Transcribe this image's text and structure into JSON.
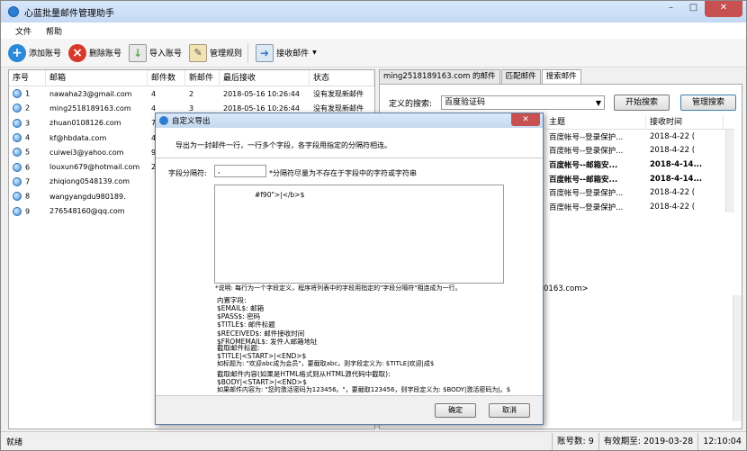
{
  "window": {
    "title": "心蓝批量邮件管理助手",
    "min": "–",
    "max": "□",
    "close": "✕"
  },
  "menu": {
    "file": "文件",
    "help": "帮助"
  },
  "toolbar": {
    "add": "添加账号",
    "delete": "删除账号",
    "import": "导入账号",
    "rules": "管理规则",
    "receive": "接收邮件",
    "receive_arrow": "▼"
  },
  "accounts": {
    "headers": [
      "序号",
      "邮箱",
      "邮件数",
      "新邮件",
      "最后接收",
      "状态"
    ],
    "rows": [
      {
        "no": "1",
        "email": "nawaha23@gmail.com",
        "count": "4",
        "new": "2",
        "last": "2018-05-16 10:26:44",
        "status": "没有发现新邮件"
      },
      {
        "no": "2",
        "email": "ming2518189163.com",
        "count": "4",
        "new": "3",
        "last": "2018-05-16 10:26:44",
        "status": "没有发现新邮件"
      },
      {
        "no": "3",
        "email": "zhuan0108126.com",
        "count": "7",
        "new": "",
        "last": "",
        "status": ""
      },
      {
        "no": "4",
        "email": "kf@hbdata.com",
        "count": "4",
        "new": "",
        "last": "",
        "status": ""
      },
      {
        "no": "5",
        "email": "cuiwei3@yahoo.com",
        "count": "9",
        "new": "",
        "last": "",
        "status": ""
      },
      {
        "no": "6",
        "email": "louxun679@hotmail.com",
        "count": "2",
        "new": "",
        "last": "",
        "status": ""
      },
      {
        "no": "7",
        "email": "zhiqiong0548139.com",
        "count": "",
        "new": "",
        "last": "",
        "status": ""
      },
      {
        "no": "8",
        "email": "wangyangdu980189.",
        "count": "",
        "new": "",
        "last": "",
        "status": ""
      },
      {
        "no": "9",
        "email": "276548160@qq.com",
        "count": "",
        "new": "",
        "last": "",
        "status": ""
      }
    ]
  },
  "right": {
    "tabs": [
      "ming2518189163.com 的邮件",
      "匹配邮件",
      "搜索邮件"
    ],
    "search_label": "定义的搜索:",
    "search_value": "百度验证码",
    "start_search": "开始搜索",
    "manage_search": "管理搜索",
    "list_headers": [
      "主题",
      "接收时间"
    ],
    "list_rows": [
      {
        "subject": "百度帐号--登录保护...",
        "time": "2018-4-22 (",
        "bold": false
      },
      {
        "subject": "百度帐号--登录保护...",
        "time": "2018-4-22 (",
        "bold": false
      },
      {
        "subject": "百度帐号--邮箱安...",
        "time": "2018-4-14...",
        "bold": true
      },
      {
        "subject": "百度帐号--邮箱安...",
        "time": "2018-4-14...",
        "bold": true
      },
      {
        "subject": "百度帐号--登录保护...",
        "time": "2018-4-22 (",
        "bold": false
      },
      {
        "subject": "百度帐号--登录保护...",
        "time": "2018-4-22 (",
        "bold": false
      }
    ],
    "preview_text": "0163.com>"
  },
  "dialog": {
    "title": "自定义导出",
    "close": "✕",
    "desc": "导出为一封邮件一行，一行多个字段，各字段用指定的分隔符相连。",
    "sep_label": "字段分隔符:",
    "sep_value": ",",
    "sep_hint": "*分隔符尽量为不存在于字段中的字符或字符串",
    "template_text": "#f90\">|</b>$",
    "note": "*说明: 每行为一个字段定义，程序将列表中的字段用指定的\"字段分隔符\"相连成为一行。",
    "builtin_title": "内置字段:",
    "builtin": [
      "$EMAIL$: 邮箱",
      "$PASS$: 密码",
      "$TITLE$: 邮件标题",
      "$RECEIVED$: 邮件接收时间",
      "$FROMEMAIL$: 发件人邮箱地址"
    ],
    "ex1_title": "截取邮件标题:",
    "ex1_code": "$TITLE|<START>|<END>$",
    "ex1_desc": "如标题为: \"欢迎abc成为会员\"，要截取abc，则字段定义为: $TITLE|欢迎|成$",
    "ex2_title": "截取邮件内容(如果是HTML格式则从HTML源代码中截取):",
    "ex2_code": "$BODY|<START>|<END>$",
    "ex2_desc": "如果邮件内容为: \"您的激活密码为123456。\"，要截取123456，则字段定义为: $BODY|激活密码为|。$",
    "ok": "确定",
    "cancel": "取消"
  },
  "status": {
    "ready": "就绪",
    "count": "账号数: 9",
    "valid": "有效期至: 2019-03-28",
    "time": "12:10:04"
  },
  "colors": {
    "add": "#2a8ad8",
    "delete": "#d83a2a",
    "import": "#5aa84a",
    "receive": "#3a78c8"
  }
}
